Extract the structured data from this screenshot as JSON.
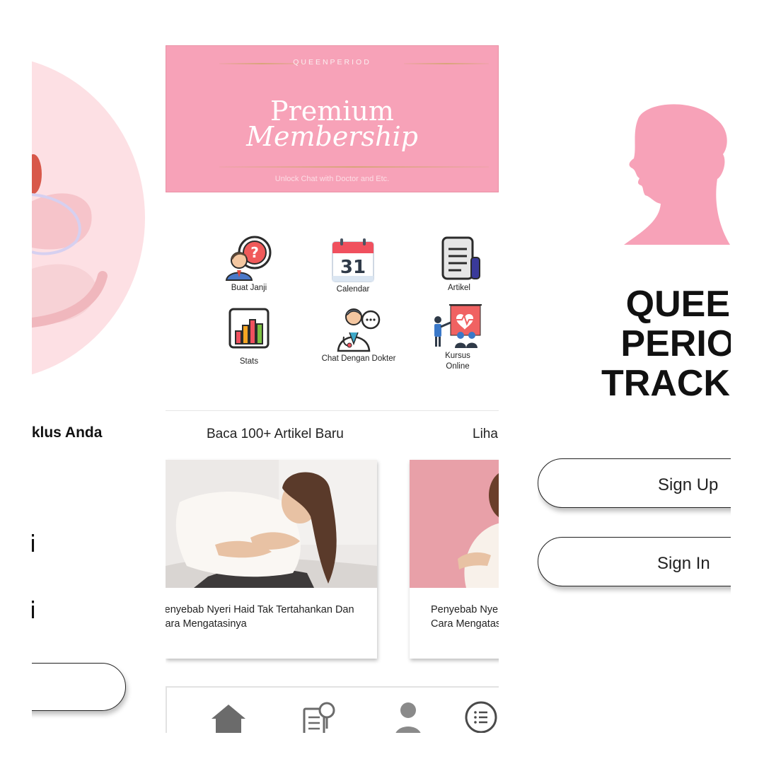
{
  "left_screen": {
    "heading": "Siklus Anda",
    "text_1": "i",
    "text_2": "i",
    "button_label": ""
  },
  "middle_screen": {
    "banner": {
      "brand": "QUEENPERIOD",
      "title_line1": "Premium",
      "title_line2": "Membership",
      "subtitle": "Unlock Chat with Doctor and Etc."
    },
    "features": [
      {
        "label": "Buat Janji",
        "icon": "appointment-icon"
      },
      {
        "label": "Calendar",
        "icon": "calendar-icon",
        "calendar_day": "31"
      },
      {
        "label": "Artikel",
        "icon": "article-icon"
      },
      {
        "label": "Stats",
        "icon": "stats-icon"
      },
      {
        "label": "Chat Dengan Dokter",
        "icon": "doctor-chat-icon"
      },
      {
        "label": "Kursus Online",
        "icon": "online-course-icon"
      }
    ],
    "articles_section": {
      "title": "Baca 100+ Artikel Baru",
      "see_all": "Liha"
    },
    "articles": [
      {
        "title": "Penyebab Nyeri Haid Tak Tertahankan Dan Cara Mengatasinya"
      },
      {
        "title": "Penyebab Nyeri Haid Tak Tertahankan Dan Cara Mengatasinya"
      }
    ],
    "bottom_nav": [
      {
        "icon": "home-icon"
      },
      {
        "icon": "document-search-icon"
      },
      {
        "icon": "profile-icon"
      },
      {
        "icon": "list-icon"
      }
    ]
  },
  "right_screen": {
    "title_line1": "QUEEN",
    "title_line2": "PERIOD",
    "title_line3": "TRACKER",
    "sign_up": "Sign Up",
    "sign_in": "Sign In"
  },
  "colors": {
    "brand_pink": "#f7a2b8",
    "light_pink": "#fde0e4",
    "photo_pink": "#e8a0a8",
    "text": "#222222",
    "nav_gray": "#6b6b6b"
  }
}
